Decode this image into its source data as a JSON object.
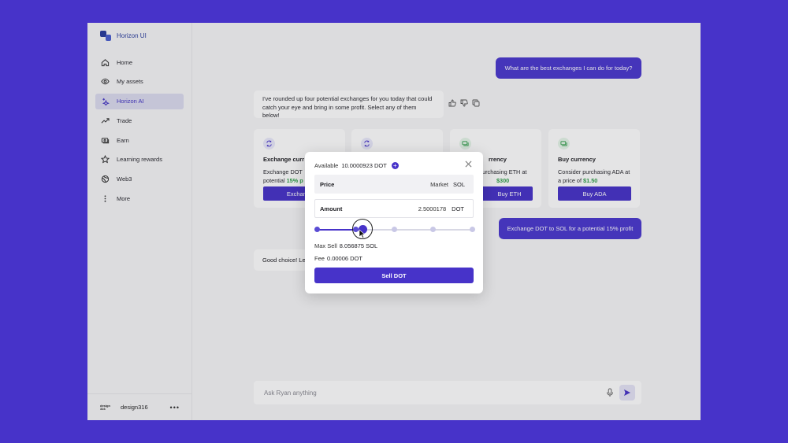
{
  "brand": {
    "name": "Horizon UI"
  },
  "sidebar": {
    "items": [
      {
        "label": "Home",
        "icon": "home-icon"
      },
      {
        "label": "My assets",
        "icon": "eye-icon"
      },
      {
        "label": "Horizon AI",
        "icon": "sparkle-icon",
        "active": true
      },
      {
        "label": "Trade",
        "icon": "trend-icon"
      },
      {
        "label": "Earn",
        "icon": "cash-icon"
      },
      {
        "label": "Learning rewards",
        "icon": "star-icon"
      },
      {
        "label": "Web3",
        "icon": "globe-icon"
      },
      {
        "label": "More",
        "icon": "more-vertical-icon"
      }
    ],
    "footer": {
      "logo_text": "design 316",
      "name": "design316",
      "more": "•••"
    }
  },
  "chat": {
    "user_message_1": "What are the best exchanges I can do for today?",
    "ai_message_1": "I've rounded up four potential exchanges for you today that could catch your eye and bring in some profit. Select any of them below!",
    "cards": [
      {
        "title": "Exchange curr",
        "desc_line1": "Exchange DOT",
        "desc_prefix": "potential ",
        "desc_highlight": "15% p",
        "desc_suffix": "",
        "button": "Exchange",
        "icon_color": "#4733c9"
      },
      {
        "title": "",
        "desc_line1": "",
        "desc_prefix": "",
        "desc_highlight": "",
        "desc_suffix": "",
        "button": "",
        "icon_color": "#4733c9"
      },
      {
        "title": "rrency",
        "desc_line1": "purchasing ETH at",
        "desc_prefix": "",
        "desc_highlight": "$300",
        "desc_suffix": "",
        "button": "Buy ETH",
        "icon_color": "#2f9e48"
      },
      {
        "title": "Buy currency",
        "desc_line1": "Consider purchasing ADA at",
        "desc_prefix": "a price of ",
        "desc_highlight": "$1.50",
        "desc_suffix": "",
        "button": "Buy ADA",
        "icon_color": "#2f9e48"
      }
    ],
    "user_message_2": "Exchange DOT to SOL for a potential 15% profit",
    "ai_message_2": "Good choice! Le",
    "composer": {
      "placeholder": "Ask Ryan anything"
    }
  },
  "modal": {
    "available_label": "Available",
    "available_value": "10.0000923 DOT",
    "price_label": "Price",
    "price_mode": "Market",
    "price_currency": "SOL",
    "amount_label": "Amount",
    "amount_value": "2.5000178",
    "amount_currency": "DOT",
    "slider": {
      "value_pct": 29.5,
      "stops": [
        0,
        25,
        50,
        75,
        100
      ]
    },
    "max_sell_label": "Max Sell",
    "max_sell_value": "8.056875 SOL",
    "fee_label": "Fee",
    "fee_value": "0.00006 DOT",
    "submit_label": "Sell DOT"
  }
}
